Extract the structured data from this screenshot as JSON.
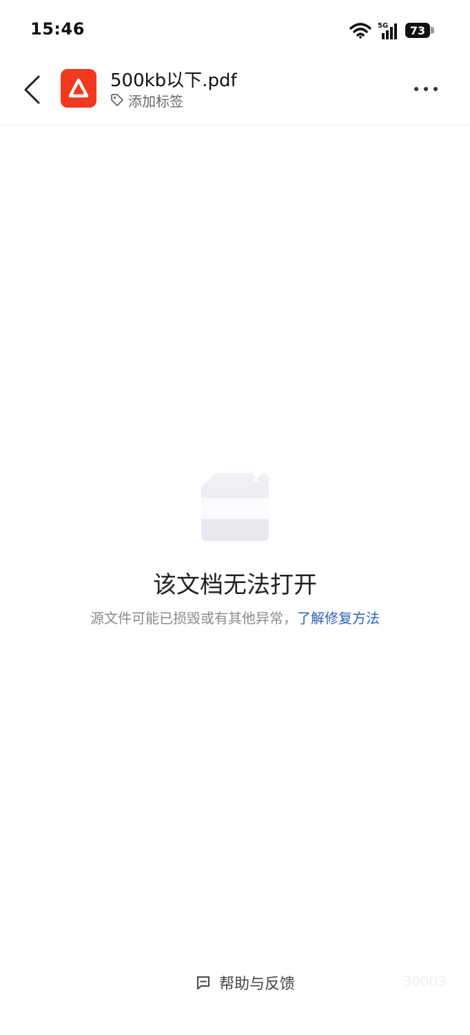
{
  "status_bar": {
    "time": "15:46",
    "network": "5G",
    "battery": "73",
    "icons": [
      "wifi-icon",
      "signal-icon",
      "battery-icon"
    ]
  },
  "header": {
    "back_icon": "chevron-left-icon",
    "app_icon": "pdf-app-icon",
    "file_title": "500kb以下.pdf",
    "tag_icon": "tag-icon",
    "tag_label": "添加标签",
    "more_icon": "more-horizontal-icon",
    "brand_color": "#f0391e"
  },
  "error": {
    "illustration": "broken-document-icon",
    "title": "该文档无法打开",
    "description": "源文件可能已损毁或有其他异常，",
    "link": "了解修复方法",
    "link_color": "#2b5fb8"
  },
  "footer": {
    "help_icon": "feedback-icon",
    "help_label": "帮助与反馈",
    "code": "30003"
  }
}
